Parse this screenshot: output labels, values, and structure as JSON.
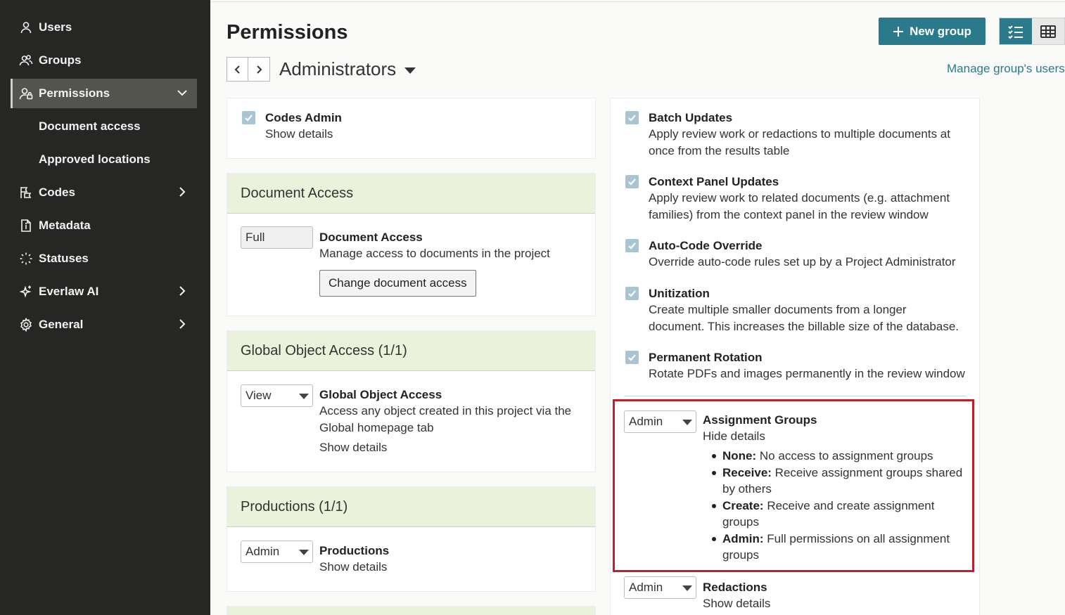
{
  "sidebar": {
    "items": [
      {
        "label": "Users",
        "icon": "user-icon"
      },
      {
        "label": "Groups",
        "icon": "group-icon"
      },
      {
        "label": "Permissions",
        "icon": "permissions-icon",
        "active": true
      },
      {
        "label": "Document access"
      },
      {
        "label": "Approved locations"
      },
      {
        "label": "Codes",
        "icon": "codes-icon"
      },
      {
        "label": "Metadata",
        "icon": "metadata-icon"
      },
      {
        "label": "Statuses",
        "icon": "statuses-icon"
      },
      {
        "label": "Everlaw AI",
        "icon": "sparkle-icon"
      },
      {
        "label": "General",
        "icon": "gear-icon"
      }
    ]
  },
  "header": {
    "title": "Permissions",
    "new_group_label": "New group",
    "group_name": "Administrators",
    "manage_link": "Manage group's users"
  },
  "left": {
    "codes_admin": {
      "title": "Codes Admin",
      "details": "Show details"
    },
    "document_access": {
      "heading": "Document Access",
      "value": "Full",
      "title": "Document Access",
      "desc": "Manage access to documents in the project",
      "button": "Change document access"
    },
    "global_object": {
      "heading": "Global Object Access (1/1)",
      "value": "View",
      "title": "Global Object Access",
      "desc1": "Access any object created in this project via the",
      "desc2": "Global homepage tab",
      "details": "Show details"
    },
    "productions": {
      "heading": "Productions (1/1)",
      "value": "Admin",
      "title": "Productions",
      "details": "Show details"
    }
  },
  "right": {
    "batch": {
      "title": "Batch Updates",
      "d1": "Apply review work or redactions to multiple documents at",
      "d2": "once from the results table"
    },
    "context": {
      "title": "Context Panel Updates",
      "d1": "Apply review work to related documents (e.g. attachment",
      "d2": "families) from the context panel in the review window"
    },
    "autocode": {
      "title": "Auto-Code Override",
      "d1": "Override auto-code rules set up by a Project Administrator"
    },
    "unitization": {
      "title": "Unitization",
      "d1": "Create multiple smaller documents from a longer",
      "d2": "document. This increases the billable size of the database."
    },
    "rotation": {
      "title": "Permanent Rotation",
      "d1": "Rotate PDFs and images permanently in the review window"
    },
    "assignment": {
      "value": "Admin",
      "title": "Assignment Groups",
      "details": "Hide details",
      "b1_key": "None:",
      "b1_text": "No access to assignment groups",
      "b2_key": "Receive:",
      "b2_text": "Receive assignment groups shared",
      "b2_text2": "by others",
      "b3_key": "Create:",
      "b3_text": "Receive and create assignment",
      "b3_text2": "groups",
      "b4_key": "Admin:",
      "b4_text": "Full permissions on all assignment",
      "b4_text2": "groups"
    },
    "redactions": {
      "value": "Admin",
      "title": "Redactions",
      "details": "Show details"
    }
  },
  "colors": {
    "accent": "#2b7a8c",
    "highlight": "#c0202a",
    "sidebar": "#262624",
    "card_head": "#eaf2dc"
  }
}
